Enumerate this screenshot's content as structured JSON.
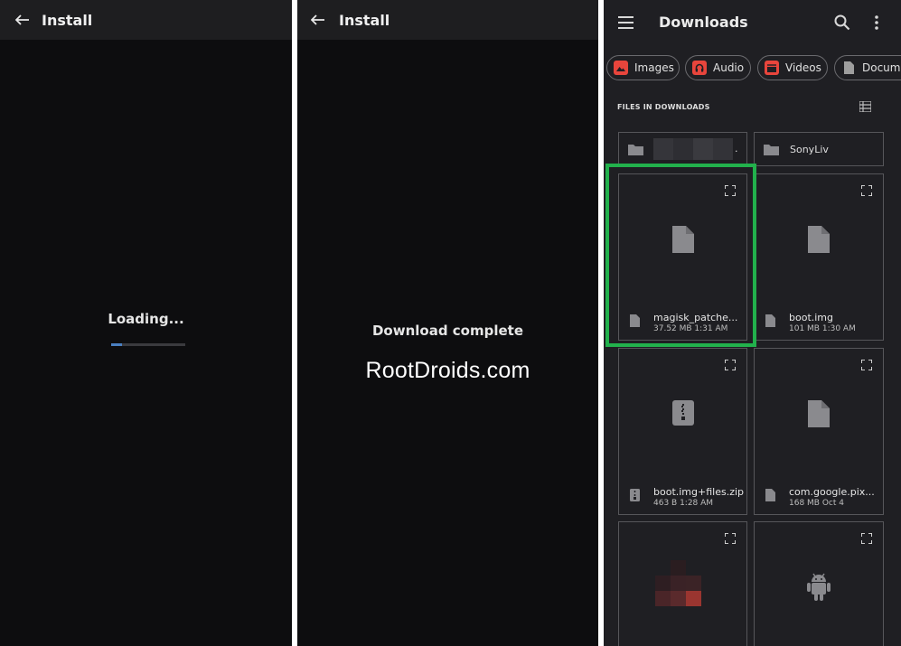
{
  "panel1": {
    "title": "Install",
    "status": "Loading...",
    "progress_fraction": 0.15
  },
  "panel2": {
    "title": "Install",
    "status": "Download complete",
    "watermark": "RootDroids.com"
  },
  "downloads": {
    "title": "Downloads",
    "chips": [
      {
        "label": "Images",
        "icon": "image-icon",
        "color": "#e8453c"
      },
      {
        "label": "Audio",
        "icon": "headphones-icon",
        "color": "#e8453c"
      },
      {
        "label": "Videos",
        "icon": "video-icon",
        "color": "#e8453c"
      },
      {
        "label": "Docume",
        "icon": "document-icon",
        "color": "#9e9e9e"
      }
    ],
    "section_label": "FILES IN DOWNLOADS",
    "folders": [
      {
        "name": "."
      },
      {
        "name": "SonyLiv"
      }
    ],
    "files": [
      {
        "name": "magisk_patche...",
        "meta": "37.52 MB 1:31 AM",
        "icon": "file-icon"
      },
      {
        "name": "boot.img",
        "meta": "101 MB 1:30 AM",
        "icon": "file-icon"
      },
      {
        "name": "boot.img+files.zip",
        "meta": "463 B 1:28 AM",
        "icon": "zip-icon"
      },
      {
        "name": "com.google.pix...",
        "meta": "168 MB Oct 4",
        "icon": "file-icon"
      }
    ],
    "highlight_color": "#22b14c"
  }
}
